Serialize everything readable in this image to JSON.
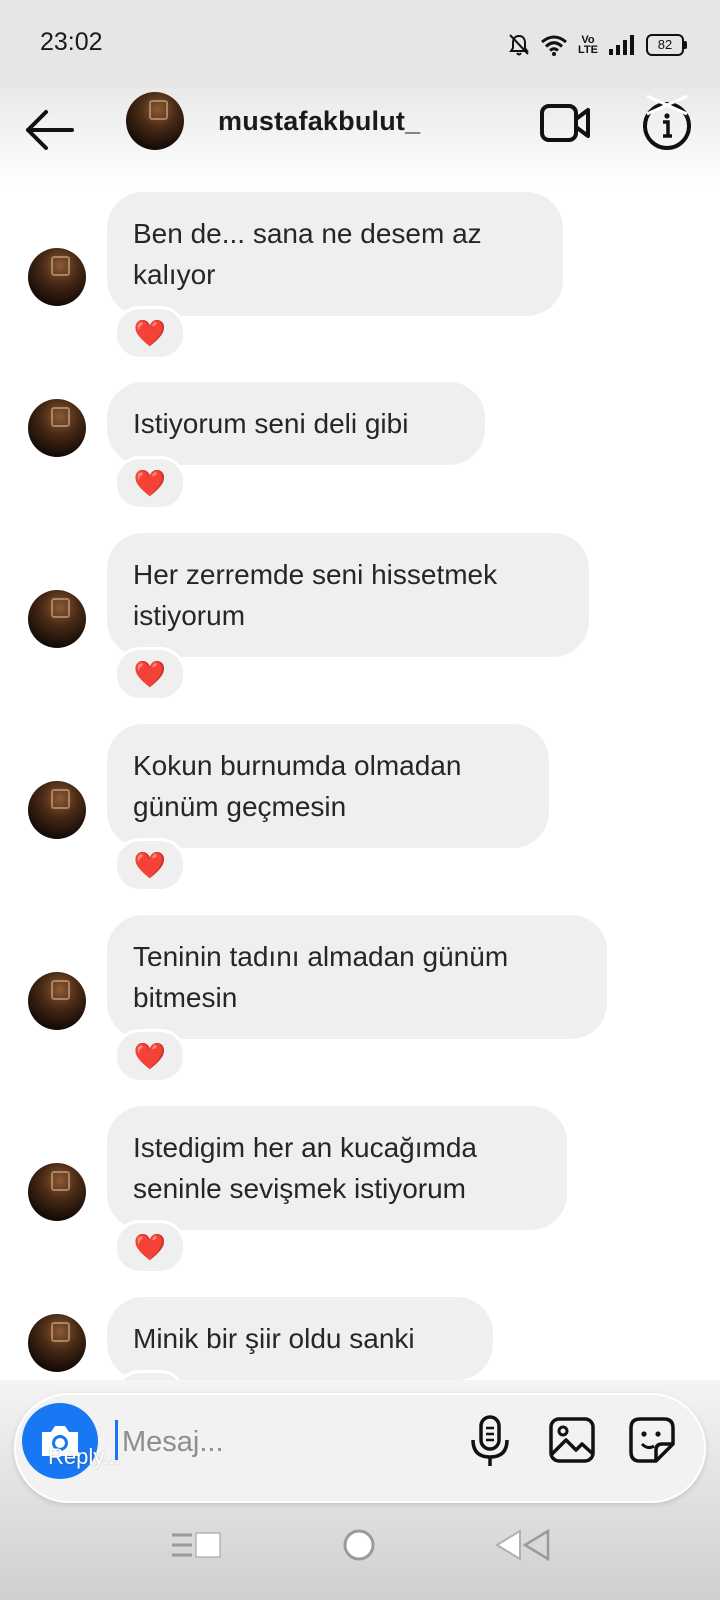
{
  "status_bar": {
    "time": "23:02",
    "volte_top": "Vo",
    "volte_bottom": "LTE",
    "battery": "82"
  },
  "header": {
    "username": "mustafakbulut_",
    "icons": [
      "back-arrow-icon",
      "video-camera-icon",
      "info-icon"
    ]
  },
  "messages": [
    {
      "text": "Ben de... sana ne desem az\nkalıyor",
      "reaction": "❤️"
    },
    {
      "text": "Istiyorum seni deli gibi",
      "reaction": "❤️"
    },
    {
      "text": "Her zerremde seni hissetmek\nistiyorum",
      "reaction": "❤️"
    },
    {
      "text": "Kokun burnumda olmadan\ngünüm geçmesin",
      "reaction": "❤️"
    },
    {
      "text": "Teninin tadını almadan günüm\nbitmesin",
      "reaction": "❤️"
    },
    {
      "text": "Istedigim her an kucağımda\nseninle sevişmek istiyorum",
      "reaction": "❤️"
    },
    {
      "text": "Minik bir şiir oldu sanki",
      "reaction": "❤️"
    }
  ],
  "composer": {
    "placeholder": "Mesaj...",
    "overlay_text": "Reply...",
    "icons": [
      "camera-icon",
      "microphone-icon",
      "gallery-icon",
      "sticker-icon"
    ]
  },
  "colors": {
    "accent": "#1877f2",
    "bubble": "#efefef",
    "heart": "#e0242c"
  }
}
